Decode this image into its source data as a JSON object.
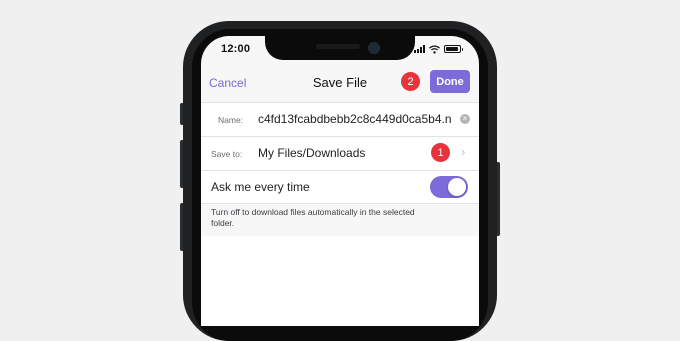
{
  "status": {
    "time": "12:00"
  },
  "nav": {
    "cancel": "Cancel",
    "title": "Save File",
    "done": "Done"
  },
  "markers": {
    "one": "1",
    "two": "2"
  },
  "form": {
    "name_label": "Name:",
    "name_value": "c4fd13fcabdbebb2c8c449d0ca5b4.n",
    "save_to_label": "Save to:",
    "save_to_value": "My Files/Downloads",
    "ask_label": "Ask me every time",
    "ask_toggle_on": true,
    "footnote": "Turn off to download files automatically in the selected folder."
  },
  "colors": {
    "accent": "#7c6bd8",
    "marker": "#e8323c",
    "background": "#f0f0f1"
  },
  "icons": {
    "clear": "clear-circle-icon",
    "chevron": "chevron-right-icon",
    "wifi": "wifi-icon",
    "battery": "battery-icon"
  }
}
